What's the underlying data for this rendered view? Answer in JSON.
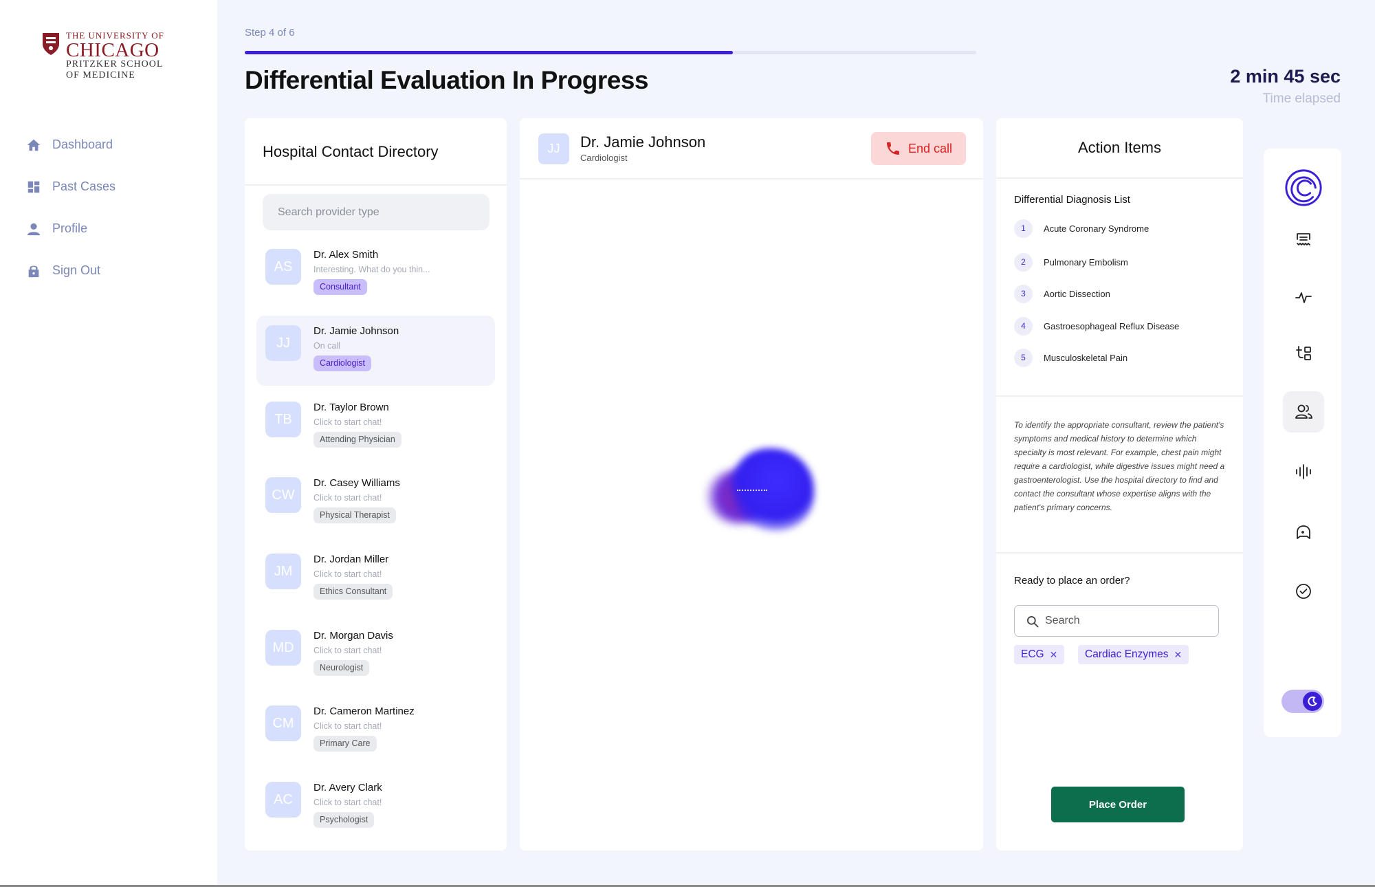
{
  "logo": {
    "line1": "THE UNIVERSITY OF",
    "line2": "CHICAGO",
    "line3": "PRITZKER SCHOOL",
    "line4": "OF MEDICINE",
    "color": "#8a1c25"
  },
  "nav": [
    {
      "label": "Dashboard",
      "icon": "home-icon"
    },
    {
      "label": "Past Cases",
      "icon": "grid-icon"
    },
    {
      "label": "Profile",
      "icon": "user-icon"
    },
    {
      "label": "Sign Out",
      "icon": "lock-icon"
    }
  ],
  "header": {
    "step": "Step 4 of 6",
    "progress": 0.667,
    "title": "Differential Evaluation In Progress",
    "timer_value": "2 min 45 sec",
    "timer_label": "Time elapsed"
  },
  "directory": {
    "title": "Hospital Contact Directory",
    "search_placeholder": "Search provider type",
    "contacts": [
      {
        "initials": "AS",
        "name": "Dr. Alex Smith",
        "sub": "Interesting. What do you thin...",
        "tag": "Consultant",
        "highlight": true
      },
      {
        "initials": "JJ",
        "name": "Dr. Jamie Johnson",
        "sub": "On call",
        "tag": "Cardiologist",
        "highlight": true,
        "active": true
      },
      {
        "initials": "TB",
        "name": "Dr. Taylor Brown",
        "sub": "Click to start chat!",
        "tag": "Attending Physician"
      },
      {
        "initials": "CW",
        "name": "Dr. Casey Williams",
        "sub": "Click to start chat!",
        "tag": "Physical Therapist"
      },
      {
        "initials": "JM",
        "name": "Dr. Jordan Miller",
        "sub": "Click to start chat!",
        "tag": "Ethics Consultant"
      },
      {
        "initials": "MD",
        "name": "Dr. Morgan Davis",
        "sub": "Click to start chat!",
        "tag": "Neurologist"
      },
      {
        "initials": "CM",
        "name": "Dr. Cameron Martinez",
        "sub": "Click to start chat!",
        "tag": "Primary Care"
      },
      {
        "initials": "AC",
        "name": "Dr. Avery Clark",
        "sub": "Click to start chat!",
        "tag": "Psychologist"
      }
    ]
  },
  "call": {
    "initials": "JJ",
    "name": "Dr. Jamie Johnson",
    "role": "Cardiologist",
    "end_call_label": "End call"
  },
  "actions": {
    "title": "Action Items",
    "ddx_title": "Differential Diagnosis List",
    "ddx": [
      {
        "num": "1",
        "label": "Acute Coronary Syndrome"
      },
      {
        "num": "2",
        "label": "Pulmonary Embolism"
      },
      {
        "num": "3",
        "label": "Aortic Dissection"
      },
      {
        "num": "4",
        "label": "Gastroesophageal Reflux Disease"
      },
      {
        "num": "5",
        "label": "Musculoskeletal Pain"
      }
    ],
    "guidance": "To identify the appropriate consultant, review the patient's symptoms and medical history to determine which specialty is most relevant. For example, chest pain might require a cardiologist, while digestive issues might need a gastroenterologist. Use the hospital directory to find and contact the consultant whose expertise aligns with the patient's primary concerns.",
    "order_question": "Ready to place an order?",
    "order_search_placeholder": "Search",
    "chips": [
      "ECG",
      "Cardiac Enzymes"
    ],
    "place_order_label": "Place Order"
  },
  "rail": {
    "items": [
      "brand-logo-icon",
      "notes-icon",
      "heartbeat-icon",
      "tools-icon",
      "users-icon",
      "audio-wave-icon",
      "chat-icon",
      "check-circle-icon"
    ],
    "active": "users-icon",
    "theme_toggle": "dark-mode"
  },
  "colors": {
    "accent": "#3b1fd6",
    "end_call": "#d72323",
    "place_order": "#0d6e4e"
  }
}
